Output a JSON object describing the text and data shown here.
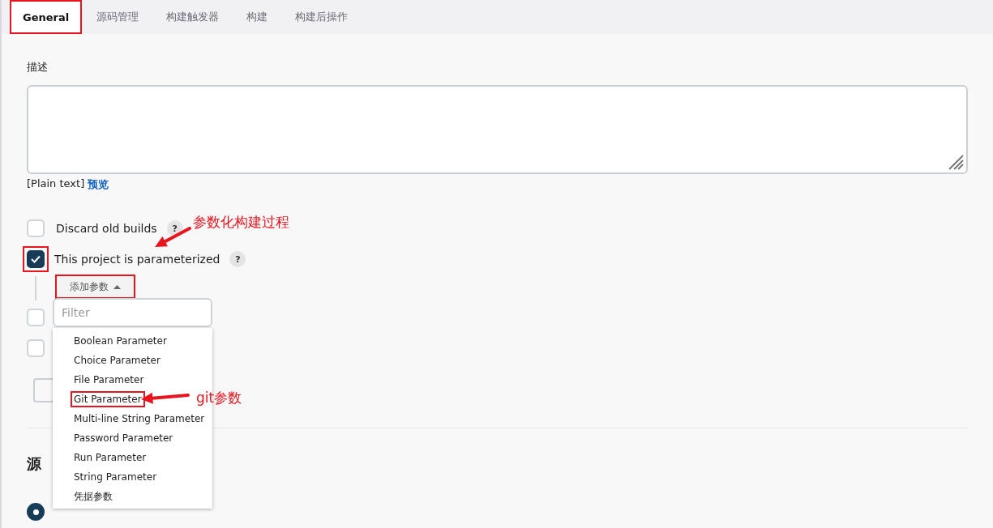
{
  "tabs": [
    {
      "label": "General",
      "selected": true,
      "boxed": true
    },
    {
      "label": "源码管理",
      "selected": false,
      "boxed": false
    },
    {
      "label": "构建触发器",
      "selected": false,
      "boxed": false
    },
    {
      "label": "构建",
      "selected": false,
      "boxed": false
    },
    {
      "label": "构建后操作",
      "selected": false,
      "boxed": false
    }
  ],
  "description_label": "描述",
  "format_note": "[Plain text]",
  "preview_link": "预览",
  "options": [
    {
      "label": "Discard old builds",
      "help": "?",
      "checked": false,
      "boxed": false
    },
    {
      "label": "This project is parameterized",
      "help": "?",
      "checked": true,
      "boxed": true
    },
    {
      "checked": false,
      "boxed": false
    },
    {
      "checked": false,
      "boxed": false
    }
  ],
  "add_parameter_button": {
    "label": "添加参数",
    "boxed": true
  },
  "filter": {
    "placeholder": "Filter"
  },
  "menu_items": [
    {
      "label": "Boolean Parameter",
      "boxed": false
    },
    {
      "label": "Choice Parameter",
      "boxed": false
    },
    {
      "label": "File Parameter",
      "boxed": false
    },
    {
      "label": "Git Parameter",
      "boxed": true
    },
    {
      "label": "Multi-line String Parameter",
      "boxed": false
    },
    {
      "label": "Password Parameter",
      "boxed": false
    },
    {
      "label": "Run Parameter",
      "boxed": false
    },
    {
      "label": "String Parameter",
      "boxed": false
    },
    {
      "label": "凭据参数",
      "boxed": false
    }
  ],
  "section_heading": "源",
  "radio": {
    "selected": true
  },
  "annotations": [
    {
      "text": "参数化构建过程"
    },
    {
      "text": "git参数"
    }
  ]
}
